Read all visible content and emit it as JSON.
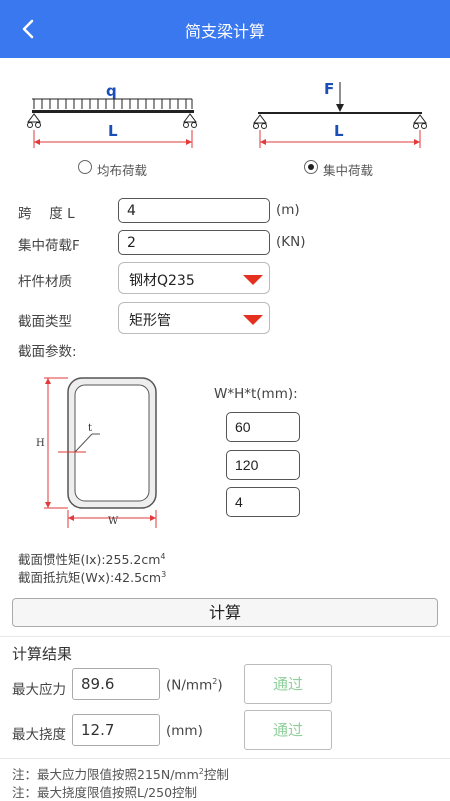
{
  "header": {
    "title": "简支梁计算"
  },
  "diagrams": {
    "uniform": {
      "load_symbol": "q",
      "length_symbol": "L",
      "option_label": "均布荷载",
      "selected": false
    },
    "point": {
      "load_symbol": "F",
      "length_symbol": "L",
      "option_label": "集中荷载",
      "selected": true
    }
  },
  "form": {
    "span": {
      "label": "跨　 度 L",
      "value": "4",
      "unit": "(m)"
    },
    "load": {
      "label": "集中荷载F",
      "value": "2",
      "unit": "(KN)"
    },
    "material": {
      "label": "杆件材质",
      "value": "钢材Q235"
    },
    "section_type": {
      "label": "截面类型",
      "value": "矩形管"
    },
    "section_params_label": "截面参数:"
  },
  "section": {
    "dims_label": "W*H*t(mm):",
    "w": "60",
    "h": "120",
    "t": "4",
    "label_t": "t",
    "label_h": "H",
    "label_w": "W",
    "inertia_prefix": "截面惯性矩(Ix):255.2cm",
    "inertia_exp": "4",
    "modulus_prefix": "截面抵抗矩(Wx):42.5cm",
    "modulus_exp": "3"
  },
  "calc_button": "计算",
  "results": {
    "title": "计算结果",
    "stress": {
      "label": "最大应力",
      "value": "89.6",
      "unit_prefix": "(N/mm",
      "unit_exp": "2",
      "unit_suffix": ")",
      "status": "通过"
    },
    "deflection": {
      "label": "最大挠度",
      "value": "12.7",
      "unit": "(mm)",
      "status": "通过"
    }
  },
  "notes": {
    "line1_prefix": "注：最大应力限值按照215N/mm",
    "line1_exp": "2",
    "line1_suffix": "控制",
    "line2": "注：最大挠度限值按照L/250控制"
  },
  "colors": {
    "header": "#3a78f0",
    "caret": "#e53020",
    "dimension": "#e23a3a",
    "pass": "#8fd09a"
  }
}
